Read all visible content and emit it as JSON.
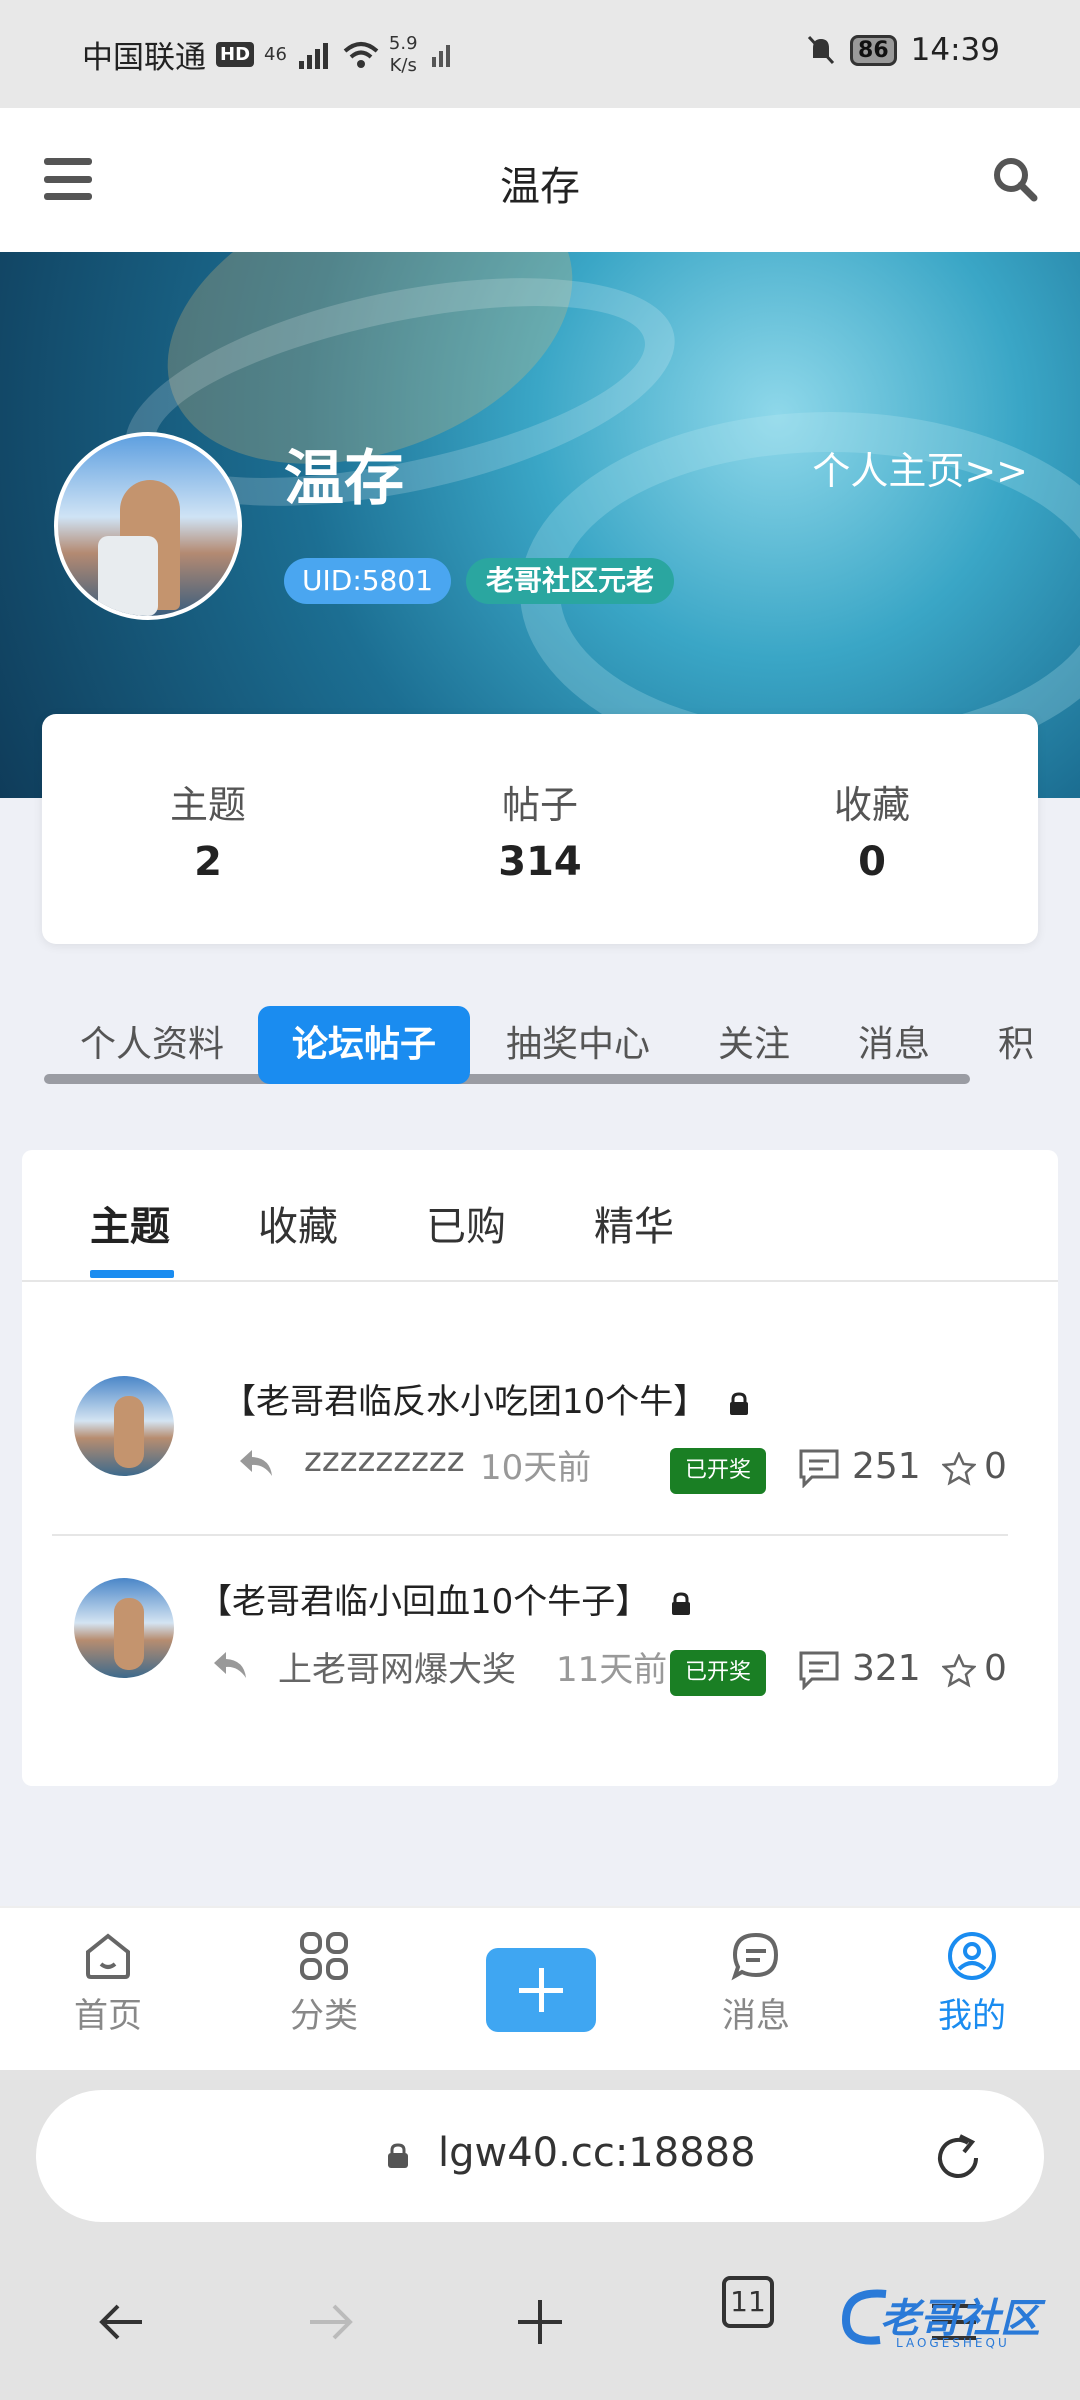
{
  "status_bar": {
    "carrier": "中国联通",
    "hd": "HD",
    "network": "46",
    "speed_value": "5.9",
    "speed_unit": "K/s",
    "battery": "86",
    "time": "14:39"
  },
  "header": {
    "title": "温存"
  },
  "profile": {
    "name": "温存",
    "homepage_link": "个人主页>>",
    "uid_badge": "UID:5801",
    "rank_badge": "老哥社区元老"
  },
  "stats": [
    {
      "label": "主题",
      "value": "2"
    },
    {
      "label": "帖子",
      "value": "314"
    },
    {
      "label": "收藏",
      "value": "0"
    }
  ],
  "tabs": [
    "个人资料",
    "论坛帖子",
    "抽奖中心",
    "关注",
    "消息",
    "积"
  ],
  "active_tab": "论坛帖子",
  "subtabs": [
    "主题",
    "收藏",
    "已购",
    "精华"
  ],
  "posts": [
    {
      "title": "【老哥君临反水小吃团10个牛】",
      "author": "zzzzzzzzz",
      "time": "10天前",
      "status": "已开奖",
      "comments": "251",
      "favorites": "0"
    },
    {
      "title": "【老哥君临小回血10个牛子】",
      "author": "上老哥网爆大奖",
      "time": "11天前",
      "status": "已开奖",
      "comments": "321",
      "favorites": "0"
    }
  ],
  "bottom_nav": [
    {
      "label": "首页",
      "icon": "home-icon"
    },
    {
      "label": "分类",
      "icon": "grid-icon"
    },
    {
      "label": "消息",
      "icon": "message-icon"
    },
    {
      "label": "我的",
      "icon": "user-icon"
    }
  ],
  "browser": {
    "url": "lgw40.cc:18888",
    "tab_count": "11"
  },
  "watermark": {
    "text": "老哥社区",
    "sub": "LAOGESHEQU"
  },
  "colors": {
    "accent": "#1a8cf0",
    "status_green": "#1a7f24",
    "badge_teal": "#2aa6a0"
  }
}
